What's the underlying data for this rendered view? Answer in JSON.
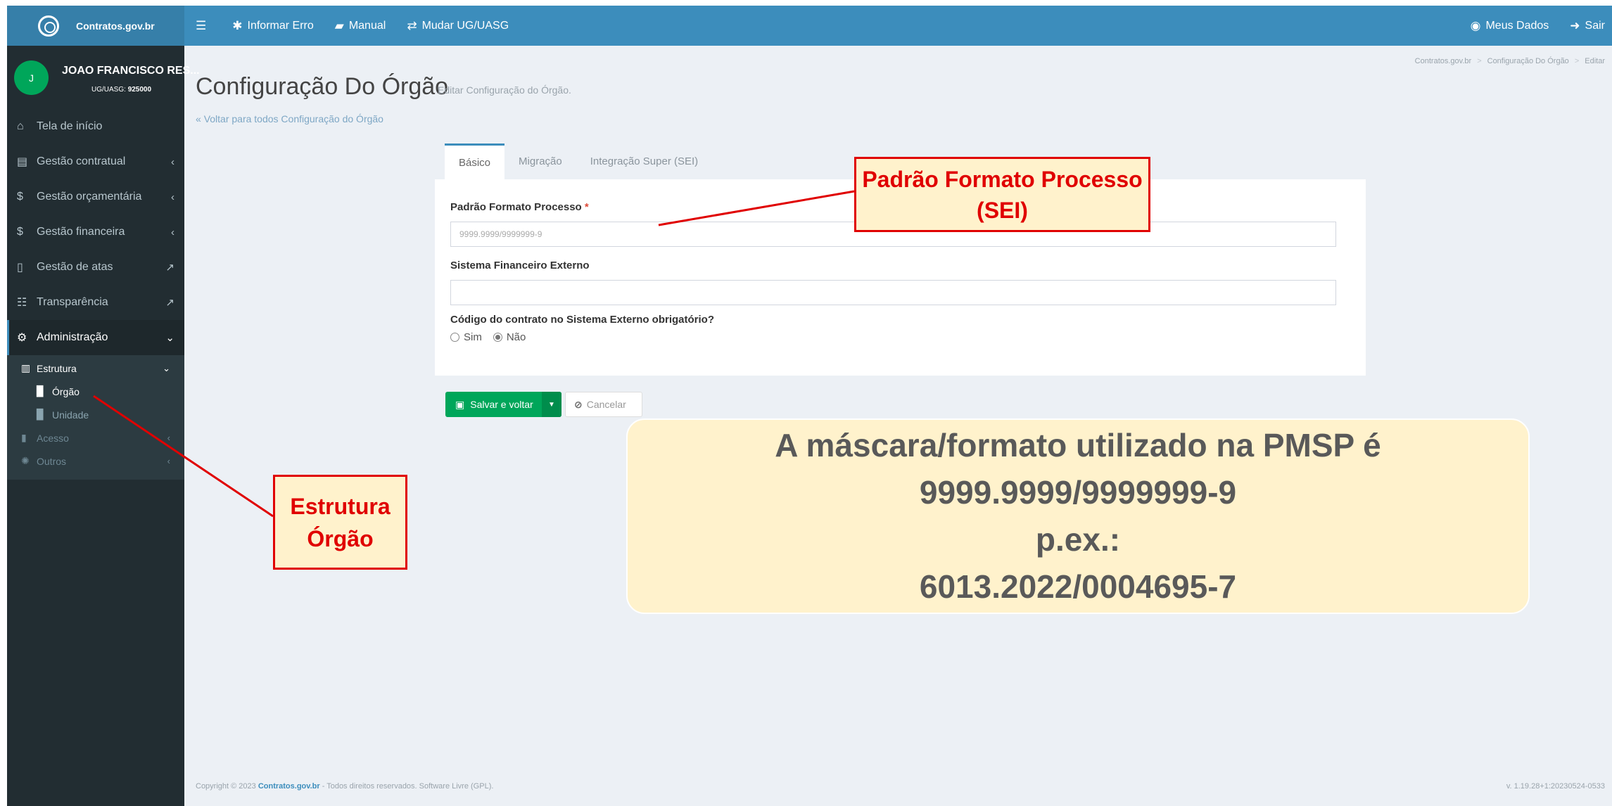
{
  "brand": {
    "name": "Contratos.gov.br"
  },
  "topbar": {
    "menu_icon": "hamburger-icon",
    "informar_erro": "Informar Erro",
    "manual": "Manual",
    "mudar": "Mudar UG/UASG",
    "meus_dados": "Meus Dados",
    "sair": "Sair"
  },
  "user": {
    "initial": "J",
    "name": "JOAO FRANCISCO RES...",
    "uasg_label": "UG/UASG:",
    "uasg_value": "925000"
  },
  "sidebar": {
    "items": [
      {
        "label": "Tela de início",
        "icon": "home-icon"
      },
      {
        "label": "Gestão contratual",
        "icon": "document-icon"
      },
      {
        "label": "Gestão orçamentária",
        "icon": "dollar-icon"
      },
      {
        "label": "Gestão financeira",
        "icon": "dollar-icon"
      },
      {
        "label": "Gestão de atas",
        "icon": "file-icon"
      },
      {
        "label": "Transparência",
        "icon": "list-icon"
      },
      {
        "label": "Administração",
        "icon": "cogs-icon"
      }
    ],
    "sub": {
      "estrutura": "Estrutura",
      "orgao": "Órgão",
      "unidade": "Unidade",
      "acesso": "Acesso",
      "outros": "Outros"
    }
  },
  "page": {
    "title": "Configuração Do Órgão",
    "subtitle": "Editar Configuração do Órgão.",
    "back_link": "Voltar para todos Configuração do Órgão",
    "breadcrumb": [
      "Contratos.gov.br",
      "Configuração Do Órgão",
      "Editar"
    ]
  },
  "tabs": [
    "Básico",
    "Migração",
    "Integração Super (SEI)"
  ],
  "form": {
    "field1_label": "Padrão Formato Processo",
    "field1_required": "*",
    "field1_placeholder": "9999.9999/9999999-9",
    "field2_label": "Sistema Financeiro Externo",
    "field2_value": "",
    "field3_label": "Código do contrato no Sistema Externo obrigatório?",
    "radio_sim": "Sim",
    "radio_nao": "Não",
    "radio_selected": "Não"
  },
  "buttons": {
    "save": "Salvar e voltar",
    "cancel": "Cancelar"
  },
  "footer": {
    "copyright_pre": "Copyright © 2023",
    "copyright_brand": "Contratos.gov.br",
    "copyright_post": "- Todos direitos reservados. Software Livre (GPL).",
    "version": "v. 1.19.28+1:20230524-0533"
  },
  "annotations": {
    "sei_line1": "Padrão Formato Processo",
    "sei_line2": "(SEI)",
    "estrutura_line1": "Estrutura",
    "estrutura_line2": "Órgão",
    "info_line1": "A máscara/formato utilizado na PMSP é",
    "info_line2": "9999.9999/9999999-9",
    "info_line3": "p.ex.:",
    "info_line4": "6013.2022/0004695-7"
  },
  "colors": {
    "topbar": "#3c8dbc",
    "sidebar": "#222d32",
    "save": "#00a65a",
    "annotation_red": "#e00000",
    "annotation_fill": "#fff2cc"
  }
}
